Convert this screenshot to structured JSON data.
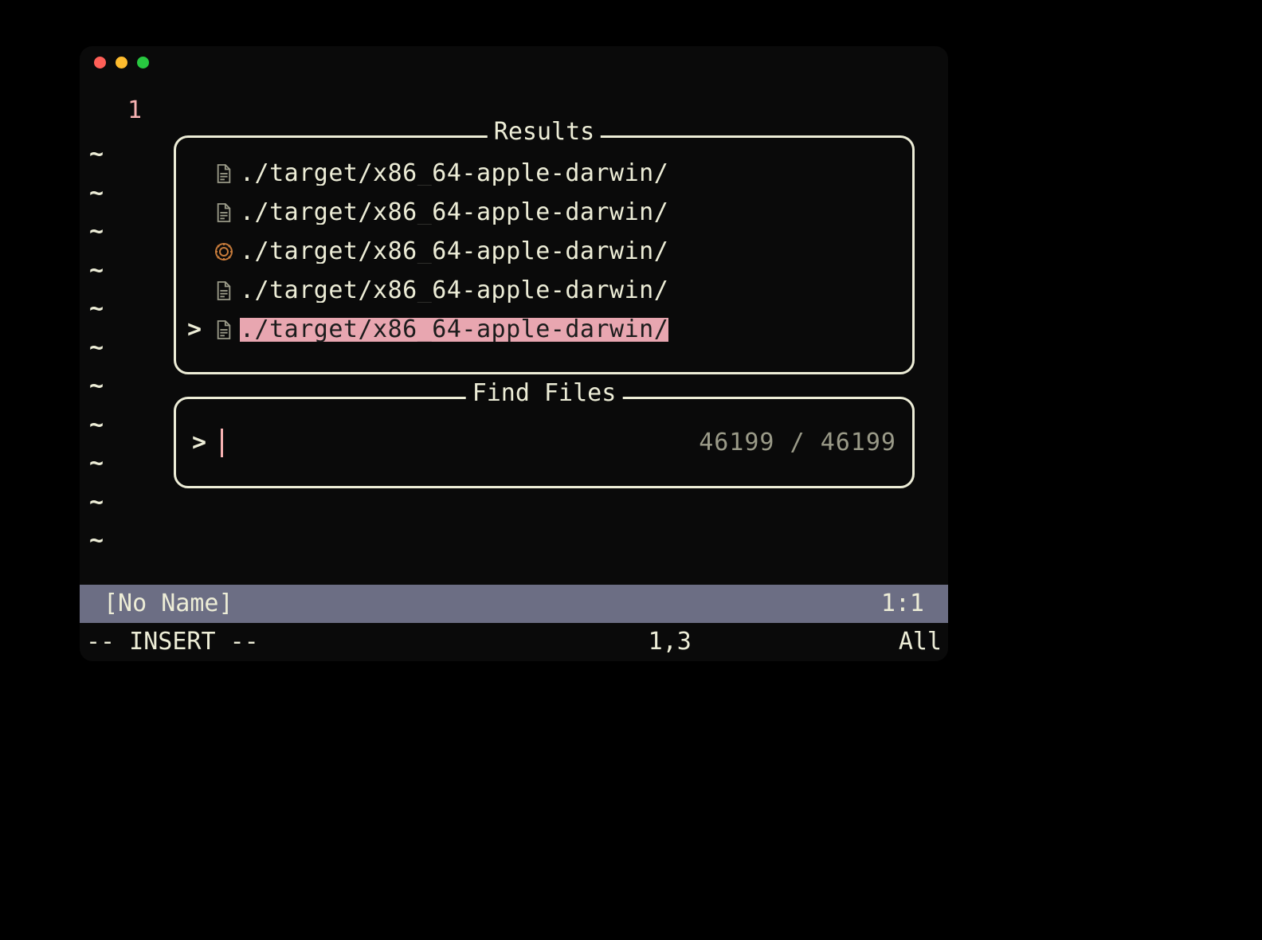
{
  "gutter": {
    "lineno": "1"
  },
  "tildes": [
    "~",
    "~",
    "~",
    "~",
    "~",
    "~",
    "~",
    "~",
    "~",
    "~",
    "~"
  ],
  "results": {
    "title": "Results",
    "items": [
      {
        "icon": "file",
        "path": "./target/x86_64-apple-darwin/",
        "selected": false
      },
      {
        "icon": "file",
        "path": "./target/x86_64-apple-darwin/",
        "selected": false
      },
      {
        "icon": "rust",
        "path": "./target/x86_64-apple-darwin/",
        "selected": false
      },
      {
        "icon": "file",
        "path": "./target/x86_64-apple-darwin/",
        "selected": false
      },
      {
        "icon": "file",
        "path": "./target/x86_64-apple-darwin/",
        "selected": true
      }
    ],
    "pointer": ">"
  },
  "find": {
    "title": "Find Files",
    "prompt": ">",
    "query": "",
    "matched": "46199",
    "total": "46199"
  },
  "statusbar": {
    "buffer_name": "[No Name]",
    "position": "1:1"
  },
  "modeline": {
    "mode": "-- INSERT --",
    "ruler_pos": "1,3",
    "ruler_pct": "All"
  }
}
